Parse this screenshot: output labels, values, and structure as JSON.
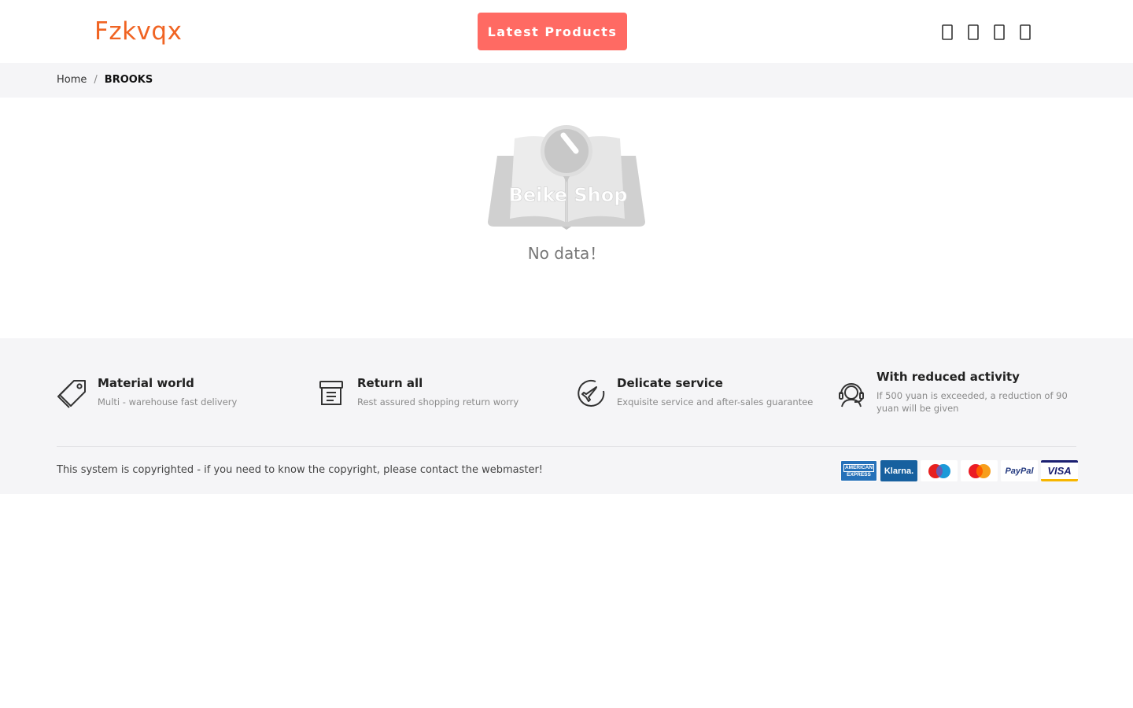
{
  "header": {
    "logo": "Fzkvqx",
    "latest_button": "Latest Products",
    "icons": [
      "search-icon",
      "user-icon",
      "heart-icon",
      "cart-icon"
    ]
  },
  "breadcrumb": {
    "home": "Home",
    "separator": "/",
    "current": "BROOKS"
  },
  "empty": {
    "illustration_text": "Beike Shop",
    "message": "No data！"
  },
  "features": [
    {
      "icon": "tag-icon",
      "title": "Material world",
      "desc": "Multi - warehouse fast delivery"
    },
    {
      "icon": "archive-box-icon",
      "title": "Return all",
      "desc": "Rest assured shopping return worry"
    },
    {
      "icon": "plane-icon",
      "title": "Delicate service",
      "desc": "Exquisite service and after-sales guarantee"
    },
    {
      "icon": "support-agent-icon",
      "title": "With reduced activity",
      "desc": "If 500 yuan is exceeded, a reduction of 90 yuan will be given"
    }
  ],
  "footer": {
    "copyright": "This system is copyrighted - if you need to know the copyright, please contact the webmaster!",
    "payments": {
      "amex_line1": "AMERICAN",
      "amex_line2": "EXPRESS",
      "klarna": "Klarna.",
      "paypal": "PayPal",
      "visa": "VISA"
    }
  },
  "colors": {
    "brand": "#f06423",
    "button": "#ff6a63",
    "band": "#f5f5f7"
  }
}
